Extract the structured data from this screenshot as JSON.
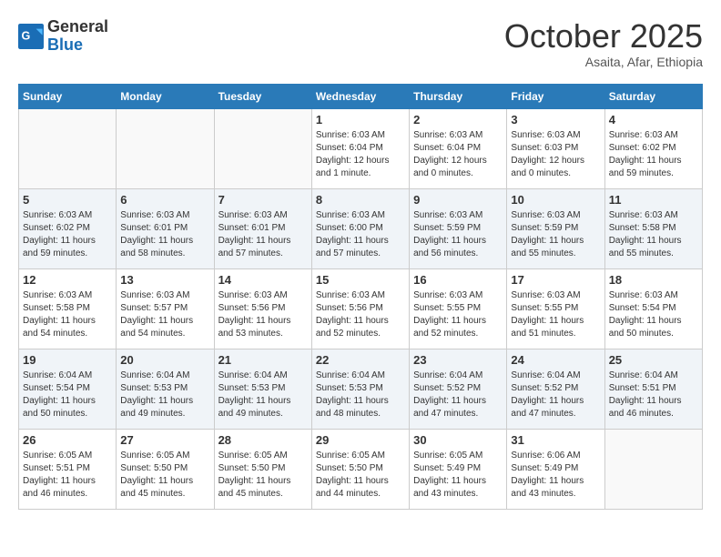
{
  "header": {
    "logo_line1": "General",
    "logo_line2": "Blue",
    "month_year": "October 2025",
    "location": "Asaita, Afar, Ethiopia"
  },
  "weekdays": [
    "Sunday",
    "Monday",
    "Tuesday",
    "Wednesday",
    "Thursday",
    "Friday",
    "Saturday"
  ],
  "weeks": [
    [
      {
        "day": "",
        "info": ""
      },
      {
        "day": "",
        "info": ""
      },
      {
        "day": "",
        "info": ""
      },
      {
        "day": "1",
        "info": "Sunrise: 6:03 AM\nSunset: 6:04 PM\nDaylight: 12 hours\nand 1 minute."
      },
      {
        "day": "2",
        "info": "Sunrise: 6:03 AM\nSunset: 6:04 PM\nDaylight: 12 hours\nand 0 minutes."
      },
      {
        "day": "3",
        "info": "Sunrise: 6:03 AM\nSunset: 6:03 PM\nDaylight: 12 hours\nand 0 minutes."
      },
      {
        "day": "4",
        "info": "Sunrise: 6:03 AM\nSunset: 6:02 PM\nDaylight: 11 hours\nand 59 minutes."
      }
    ],
    [
      {
        "day": "5",
        "info": "Sunrise: 6:03 AM\nSunset: 6:02 PM\nDaylight: 11 hours\nand 59 minutes."
      },
      {
        "day": "6",
        "info": "Sunrise: 6:03 AM\nSunset: 6:01 PM\nDaylight: 11 hours\nand 58 minutes."
      },
      {
        "day": "7",
        "info": "Sunrise: 6:03 AM\nSunset: 6:01 PM\nDaylight: 11 hours\nand 57 minutes."
      },
      {
        "day": "8",
        "info": "Sunrise: 6:03 AM\nSunset: 6:00 PM\nDaylight: 11 hours\nand 57 minutes."
      },
      {
        "day": "9",
        "info": "Sunrise: 6:03 AM\nSunset: 5:59 PM\nDaylight: 11 hours\nand 56 minutes."
      },
      {
        "day": "10",
        "info": "Sunrise: 6:03 AM\nSunset: 5:59 PM\nDaylight: 11 hours\nand 55 minutes."
      },
      {
        "day": "11",
        "info": "Sunrise: 6:03 AM\nSunset: 5:58 PM\nDaylight: 11 hours\nand 55 minutes."
      }
    ],
    [
      {
        "day": "12",
        "info": "Sunrise: 6:03 AM\nSunset: 5:58 PM\nDaylight: 11 hours\nand 54 minutes."
      },
      {
        "day": "13",
        "info": "Sunrise: 6:03 AM\nSunset: 5:57 PM\nDaylight: 11 hours\nand 54 minutes."
      },
      {
        "day": "14",
        "info": "Sunrise: 6:03 AM\nSunset: 5:56 PM\nDaylight: 11 hours\nand 53 minutes."
      },
      {
        "day": "15",
        "info": "Sunrise: 6:03 AM\nSunset: 5:56 PM\nDaylight: 11 hours\nand 52 minutes."
      },
      {
        "day": "16",
        "info": "Sunrise: 6:03 AM\nSunset: 5:55 PM\nDaylight: 11 hours\nand 52 minutes."
      },
      {
        "day": "17",
        "info": "Sunrise: 6:03 AM\nSunset: 5:55 PM\nDaylight: 11 hours\nand 51 minutes."
      },
      {
        "day": "18",
        "info": "Sunrise: 6:03 AM\nSunset: 5:54 PM\nDaylight: 11 hours\nand 50 minutes."
      }
    ],
    [
      {
        "day": "19",
        "info": "Sunrise: 6:04 AM\nSunset: 5:54 PM\nDaylight: 11 hours\nand 50 minutes."
      },
      {
        "day": "20",
        "info": "Sunrise: 6:04 AM\nSunset: 5:53 PM\nDaylight: 11 hours\nand 49 minutes."
      },
      {
        "day": "21",
        "info": "Sunrise: 6:04 AM\nSunset: 5:53 PM\nDaylight: 11 hours\nand 49 minutes."
      },
      {
        "day": "22",
        "info": "Sunrise: 6:04 AM\nSunset: 5:53 PM\nDaylight: 11 hours\nand 48 minutes."
      },
      {
        "day": "23",
        "info": "Sunrise: 6:04 AM\nSunset: 5:52 PM\nDaylight: 11 hours\nand 47 minutes."
      },
      {
        "day": "24",
        "info": "Sunrise: 6:04 AM\nSunset: 5:52 PM\nDaylight: 11 hours\nand 47 minutes."
      },
      {
        "day": "25",
        "info": "Sunrise: 6:04 AM\nSunset: 5:51 PM\nDaylight: 11 hours\nand 46 minutes."
      }
    ],
    [
      {
        "day": "26",
        "info": "Sunrise: 6:05 AM\nSunset: 5:51 PM\nDaylight: 11 hours\nand 46 minutes."
      },
      {
        "day": "27",
        "info": "Sunrise: 6:05 AM\nSunset: 5:50 PM\nDaylight: 11 hours\nand 45 minutes."
      },
      {
        "day": "28",
        "info": "Sunrise: 6:05 AM\nSunset: 5:50 PM\nDaylight: 11 hours\nand 45 minutes."
      },
      {
        "day": "29",
        "info": "Sunrise: 6:05 AM\nSunset: 5:50 PM\nDaylight: 11 hours\nand 44 minutes."
      },
      {
        "day": "30",
        "info": "Sunrise: 6:05 AM\nSunset: 5:49 PM\nDaylight: 11 hours\nand 43 minutes."
      },
      {
        "day": "31",
        "info": "Sunrise: 6:06 AM\nSunset: 5:49 PM\nDaylight: 11 hours\nand 43 minutes."
      },
      {
        "day": "",
        "info": ""
      }
    ]
  ]
}
